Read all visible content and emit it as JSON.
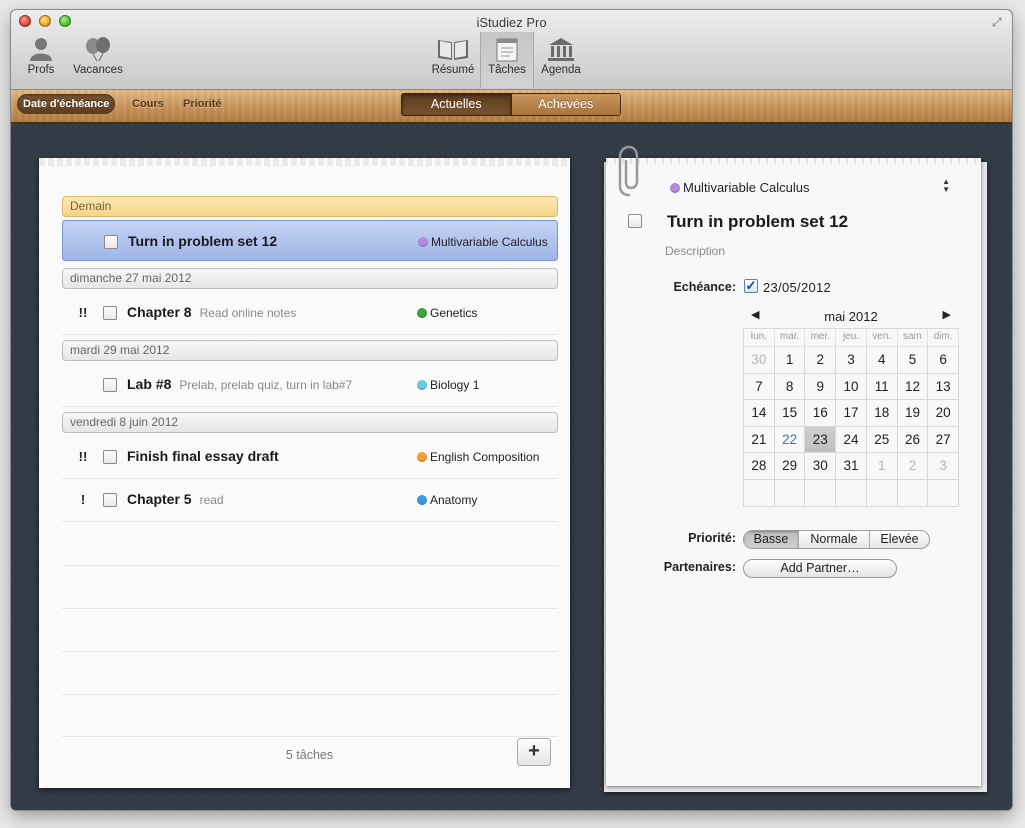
{
  "window": {
    "title": "iStudiez Pro"
  },
  "toolbar": {
    "left": [
      {
        "label": "Profs",
        "icon": "person-icon"
      },
      {
        "label": "Vacances",
        "icon": "balloons-icon"
      }
    ],
    "center": [
      {
        "label": "Résumé",
        "icon": "book-icon"
      },
      {
        "label": "Tâches",
        "icon": "notepad-icon",
        "active": true
      },
      {
        "label": "Agenda",
        "icon": "building-icon"
      }
    ]
  },
  "sortbar": {
    "items": [
      "Date d'échéance",
      "Cours",
      "Priorité"
    ],
    "active": "Date d'échéance",
    "status": [
      "Actuelles",
      "Achevées"
    ],
    "status_active": "Actuelles"
  },
  "list": {
    "groups": [
      {
        "header": "Demain"
      },
      {
        "header": "dimanche 27 mai 2012"
      },
      {
        "header": "mardi 29 mai 2012"
      },
      {
        "header": "vendredi 8 juin 2012"
      }
    ],
    "tasks": [
      {
        "priority": "",
        "title": "Turn in problem set 12",
        "note": "",
        "course": "Multivariable Calculus",
        "color": "#b48ad9",
        "selected": true
      },
      {
        "priority": "!!",
        "title": "Chapter 8",
        "note": "Read online notes",
        "course": "Genetics",
        "color": "#3aa53a"
      },
      {
        "priority": "",
        "title": "Lab #8",
        "note": "Prelab, prelab quiz, turn in lab#7",
        "course": "Biology 1",
        "color": "#6cc9e6"
      },
      {
        "priority": "!!",
        "title": "Finish final essay draft",
        "note": "",
        "course": "English Composition",
        "color": "#f0a030"
      },
      {
        "priority": "!",
        "title": "Chapter 5",
        "note": "read",
        "course": "Anatomy",
        "color": "#3a9be0"
      }
    ],
    "count_label": "5 tâches",
    "add_label": "+"
  },
  "detail": {
    "course": "Multivariable Calculus",
    "course_color": "#b48ad9",
    "title": "Turn in problem set 12",
    "description_placeholder": "Description",
    "due_label": "Echéance:",
    "due_checked": true,
    "due_value": "23/05/2012",
    "calendar": {
      "month_label": "mai 2012",
      "weekdays": [
        "lun.",
        "mar.",
        "mer.",
        "jeu.",
        "ven.",
        "sam",
        "dim."
      ],
      "weeks": [
        [
          "30",
          "1",
          "2",
          "3",
          "4",
          "5",
          "6"
        ],
        [
          "7",
          "8",
          "9",
          "10",
          "11",
          "12",
          "13"
        ],
        [
          "14",
          "15",
          "16",
          "17",
          "18",
          "19",
          "20"
        ],
        [
          "21",
          "22",
          "23",
          "24",
          "25",
          "26",
          "27"
        ],
        [
          "28",
          "29",
          "30",
          "31",
          "1",
          "2",
          "3"
        ],
        [
          "",
          "",
          "",
          "",
          "",
          "",
          ""
        ]
      ],
      "today": "22",
      "selected": "23"
    },
    "priority_label": "Priorité:",
    "priority_options": [
      "Basse",
      "Normale",
      "Elevée"
    ],
    "priority_selected": "Basse",
    "partners_label": "Partenaires:",
    "add_partner_label": "Add Partner…"
  }
}
